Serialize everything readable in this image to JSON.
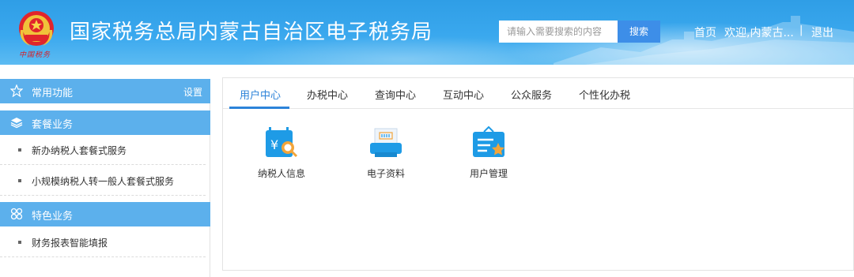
{
  "header": {
    "emblem_caption": "中国税务",
    "title": "国家税务总局内蒙古自治区电子税务局",
    "search": {
      "placeholder": "请输入需要搜索的内容",
      "button": "搜索"
    },
    "nav": {
      "home": "首页",
      "welcome": "欢迎,内蒙古...",
      "separator": "|",
      "logout": "退出"
    }
  },
  "sidebar": {
    "sections": [
      {
        "title": "常用功能",
        "icon": "star-icon",
        "extra": "设置"
      },
      {
        "title": "套餐业务",
        "icon": "layers-icon",
        "items": [
          "新办纳税人套餐式服务",
          "小规模纳税人转一般人套餐式服务"
        ]
      },
      {
        "title": "特色业务",
        "icon": "grid-icon",
        "items": [
          "财务报表智能填报"
        ]
      }
    ]
  },
  "main": {
    "tabs": [
      "用户中心",
      "办税中心",
      "查询中心",
      "互动中心",
      "公众服务",
      "个性化办税"
    ],
    "active_tab": 0,
    "tiles": [
      {
        "label": "纳税人信息",
        "icon": "taxpayer-info-icon"
      },
      {
        "label": "电子资料",
        "icon": "electronic-docs-icon"
      },
      {
        "label": "用户管理",
        "icon": "user-management-icon"
      }
    ]
  },
  "colors": {
    "header_bg": "#3aa8ee",
    "sidebar_head": "#5cb0ec",
    "accent": "#2c83d9",
    "tile_icon": "#1e9be6",
    "tile_accent": "#f3a53a"
  }
}
